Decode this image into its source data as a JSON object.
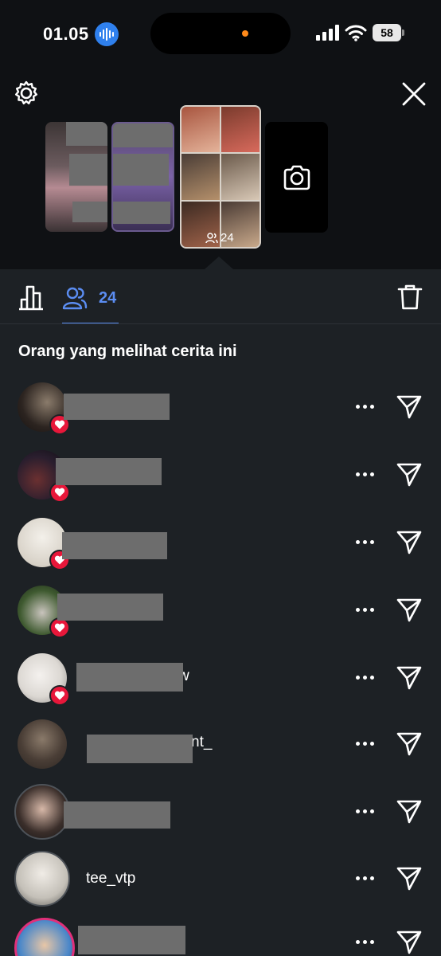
{
  "status_bar": {
    "time": "01.05",
    "battery": "58"
  },
  "thumbnails": {
    "viewer_count": "24"
  },
  "tabs": {
    "viewers_count": "24"
  },
  "section_title": "Orang yang melihat cerita ini",
  "viewers": [
    {
      "username": "",
      "liked": true
    },
    {
      "username": "",
      "liked": true
    },
    {
      "username": "",
      "liked": true
    },
    {
      "username": "",
      "liked": true
    },
    {
      "username": "w",
      "liked": true
    },
    {
      "username": "nt_",
      "liked": false
    },
    {
      "username": "",
      "liked": false
    },
    {
      "username": "tee_vtp",
      "liked": false
    },
    {
      "username": "",
      "liked": false
    }
  ],
  "colors": {
    "accent": "#5b8df2",
    "like_red": "#e8173a",
    "background": "#1d2125",
    "header_background": "#0f1114"
  }
}
